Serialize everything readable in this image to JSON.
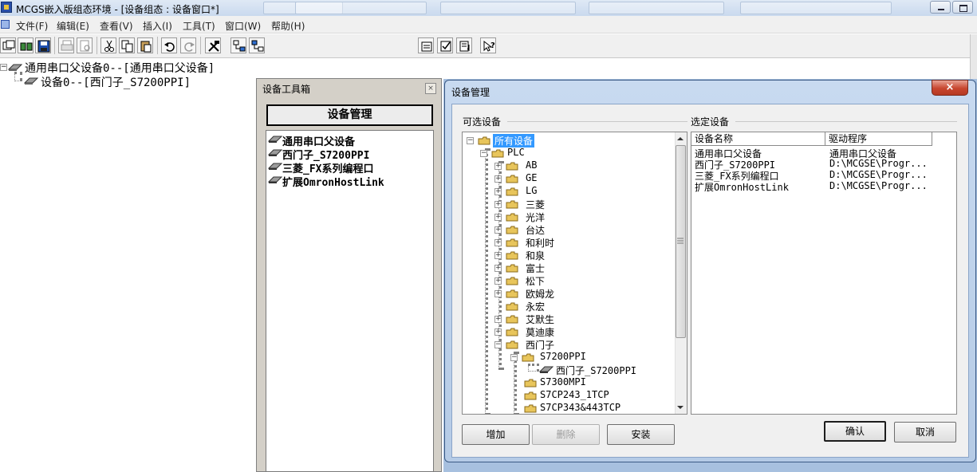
{
  "window": {
    "title": "MCGS嵌入版组态环境 - [设备组态 : 设备窗口*]"
  },
  "menu": {
    "items": [
      "文件(F)",
      "编辑(E)",
      "查看(V)",
      "插入(I)",
      "工具(T)",
      "窗口(W)",
      "帮助(H)"
    ]
  },
  "toolbar": {
    "icons": [
      "new-window-icon",
      "open-icon",
      "save-icon",
      "print-icon",
      "print-preview-icon",
      "cut-icon",
      "copy-icon",
      "paste-icon",
      "undo-icon",
      "redo-icon",
      "tools-icon",
      "device-tree-icon",
      "device-tree-alt-icon",
      "properties-icon",
      "check-icon",
      "list-icon",
      "help-icon"
    ]
  },
  "main_tree": {
    "root": "通用串口父设备0--[通用串口父设备]",
    "child": "设备0--[西门子_S7200PPI]"
  },
  "toolbox": {
    "title": "设备工具箱",
    "close_glyph": "×",
    "button": "设备管理",
    "items": [
      "通用串口父设备",
      "西门子_S7200PPI",
      "三菱_FX系列编程口",
      "扩展OmronHostLink"
    ]
  },
  "dialog": {
    "title": "设备管理",
    "close_glyph": "×",
    "available_label": "可选设备",
    "selected_label": "选定设备",
    "tree": {
      "root": "所有设备",
      "plc": "PLC",
      "vendors": [
        "AB",
        "GE",
        "LG",
        "三菱",
        "光洋",
        "台达",
        "和利时",
        "和泉",
        "富士",
        "松下",
        "欧姆龙",
        "永宏",
        "艾默生",
        "莫迪康",
        "西门子"
      ],
      "siemens_children": [
        "S7200PPI",
        "S7300MPI",
        "S7CP243_1TCP",
        "S7CP343&443TCP"
      ],
      "s7200_child": "西门子_S7200PPI"
    },
    "columns": {
      "name": "设备名称",
      "driver": "驱动程序"
    },
    "rows": [
      {
        "name": "通用串口父设备",
        "driver": "通用串口父设备"
      },
      {
        "name": "西门子_S7200PPI",
        "driver": "D:\\MCGSE\\Progr..."
      },
      {
        "name": "三菱_FX系列编程口",
        "driver": "D:\\MCGSE\\Progr..."
      },
      {
        "name": "扩展OmronHostLink",
        "driver": "D:\\MCGSE\\Progr..."
      }
    ],
    "buttons": {
      "add": "增加",
      "delete": "删除",
      "install": "安装",
      "ok": "确认",
      "cancel": "取消"
    }
  },
  "colors": {
    "selection": "#3399ff",
    "folder": "#e8c55b",
    "close_red": "#c7462f"
  }
}
